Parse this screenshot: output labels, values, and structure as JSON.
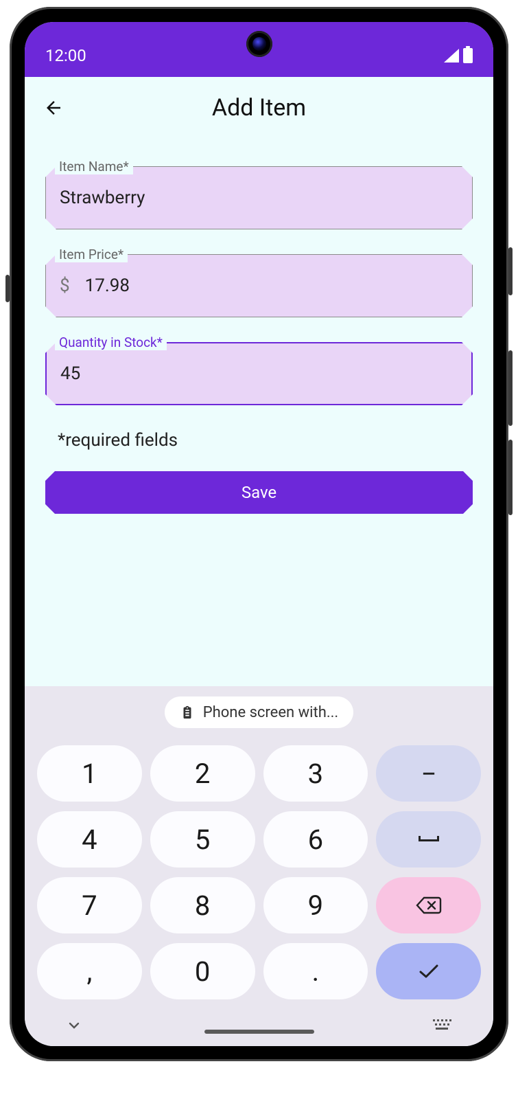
{
  "status": {
    "time": "12:00"
  },
  "appbar": {
    "title": "Add Item",
    "back_icon": "arrow-back"
  },
  "form": {
    "item_name": {
      "label": "Item Name*",
      "value": "Strawberry"
    },
    "item_price": {
      "label": "Item Price*",
      "prefix": "$",
      "value": "17.98"
    },
    "quantity": {
      "label": "Quantity in Stock*",
      "value": "45",
      "focused": true
    },
    "required_note": "*required fields",
    "save_label": "Save"
  },
  "suggestion": {
    "text": "Phone screen with...",
    "icon": "clipboard"
  },
  "keypad": {
    "rows": [
      [
        "1",
        "2",
        "3",
        "-"
      ],
      [
        "4",
        "5",
        "6",
        "␣"
      ],
      [
        "7",
        "8",
        "9",
        "⌫"
      ],
      [
        ",",
        "0",
        ".",
        "✓"
      ]
    ]
  },
  "colors": {
    "primary": "#6d28d9",
    "field_bg": "#e9d5f7",
    "app_bg": "#edfdfd"
  }
}
